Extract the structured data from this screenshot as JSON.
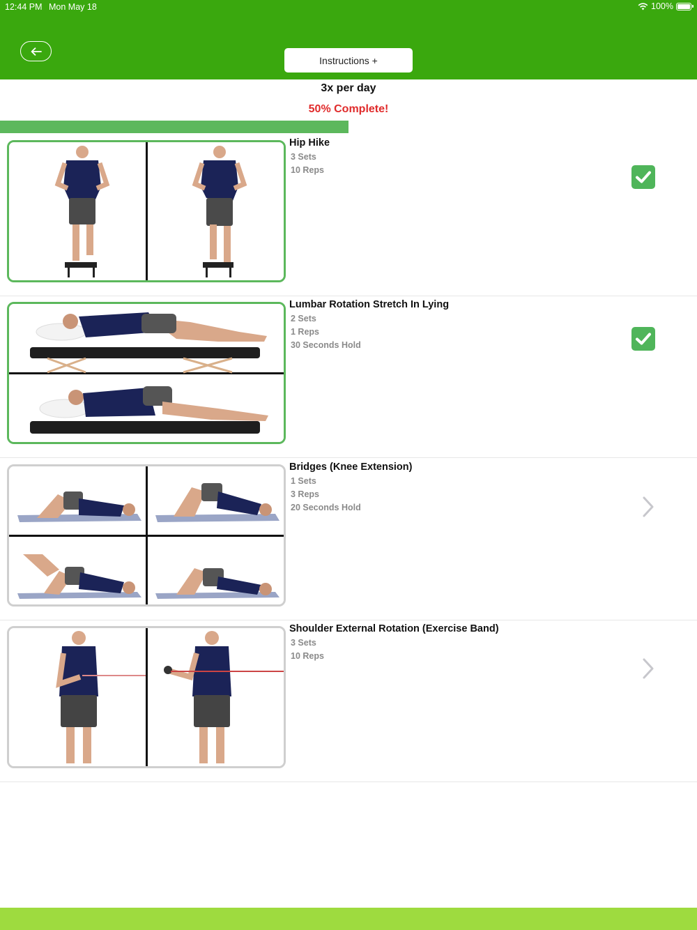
{
  "status": {
    "time": "12:44 PM",
    "date": "Mon May 18",
    "battery": "100%"
  },
  "header": {
    "back_icon": "arrow-left-icon",
    "instructions_label": "Instructions +",
    "color": "#3aa80e"
  },
  "summary": {
    "frequency": "3x per day",
    "complete_text": "50% Complete!",
    "progress": 0.5,
    "progress_color": "#5cb85c"
  },
  "exercises": [
    {
      "name": "Hip Hike",
      "details": [
        "3 Sets",
        "10 Reps"
      ],
      "status": "complete",
      "status_icon": "check-icon",
      "border_color": "#5cb85c"
    },
    {
      "name": "Lumbar Rotation Stretch In Lying",
      "details": [
        "2 Sets",
        "1 Reps",
        "30 Seconds Hold"
      ],
      "status": "complete",
      "status_icon": "check-icon",
      "border_color": "#5cb85c"
    },
    {
      "name": "Bridges (Knee Extension)",
      "details": [
        "1 Sets",
        "3 Reps",
        "20 Seconds Hold"
      ],
      "status": "pending",
      "status_icon": "chevron-right-icon",
      "border_color": "#cfcfcf"
    },
    {
      "name": "Shoulder External Rotation (Exercise Band)",
      "details": [
        "3 Sets",
        "10 Reps"
      ],
      "status": "pending",
      "status_icon": "chevron-right-icon",
      "border_color": "#cfcfcf"
    }
  ],
  "footer": {
    "color": "#9edb3f"
  }
}
